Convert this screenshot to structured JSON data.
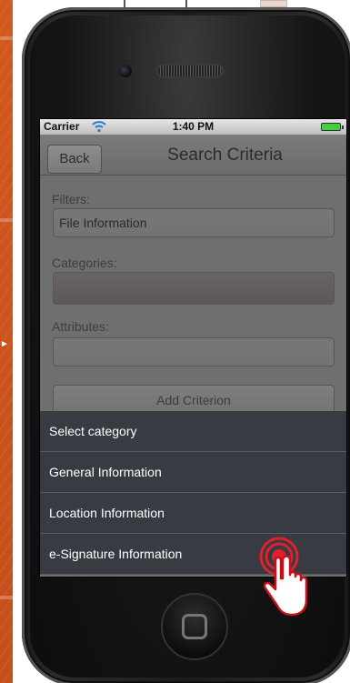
{
  "status_bar": {
    "carrier": "Carrier",
    "time": "1:40 PM",
    "wifi_icon": "wifi-icon",
    "battery_icon": "battery-icon"
  },
  "navbar": {
    "back_label": "Back",
    "title": "Search Criteria"
  },
  "form": {
    "filters_label": "Filters:",
    "filters_value": "File Information",
    "categories_label": "Categories:",
    "categories_value": "",
    "attributes_label": "Attributes:",
    "attributes_value": "",
    "add_criterion_label": "Add Criterion"
  },
  "category_sheet": {
    "items": [
      "Select category",
      "General Information",
      "Location Information",
      "e-Signature Information"
    ]
  },
  "colors": {
    "slide_background": "#c8501c",
    "sheet_background": "#383c42",
    "tap_indicator": "#e0202a"
  },
  "icons": {
    "tap_indicator": "tap-hand-icon",
    "home_button": "home-button-icon"
  }
}
